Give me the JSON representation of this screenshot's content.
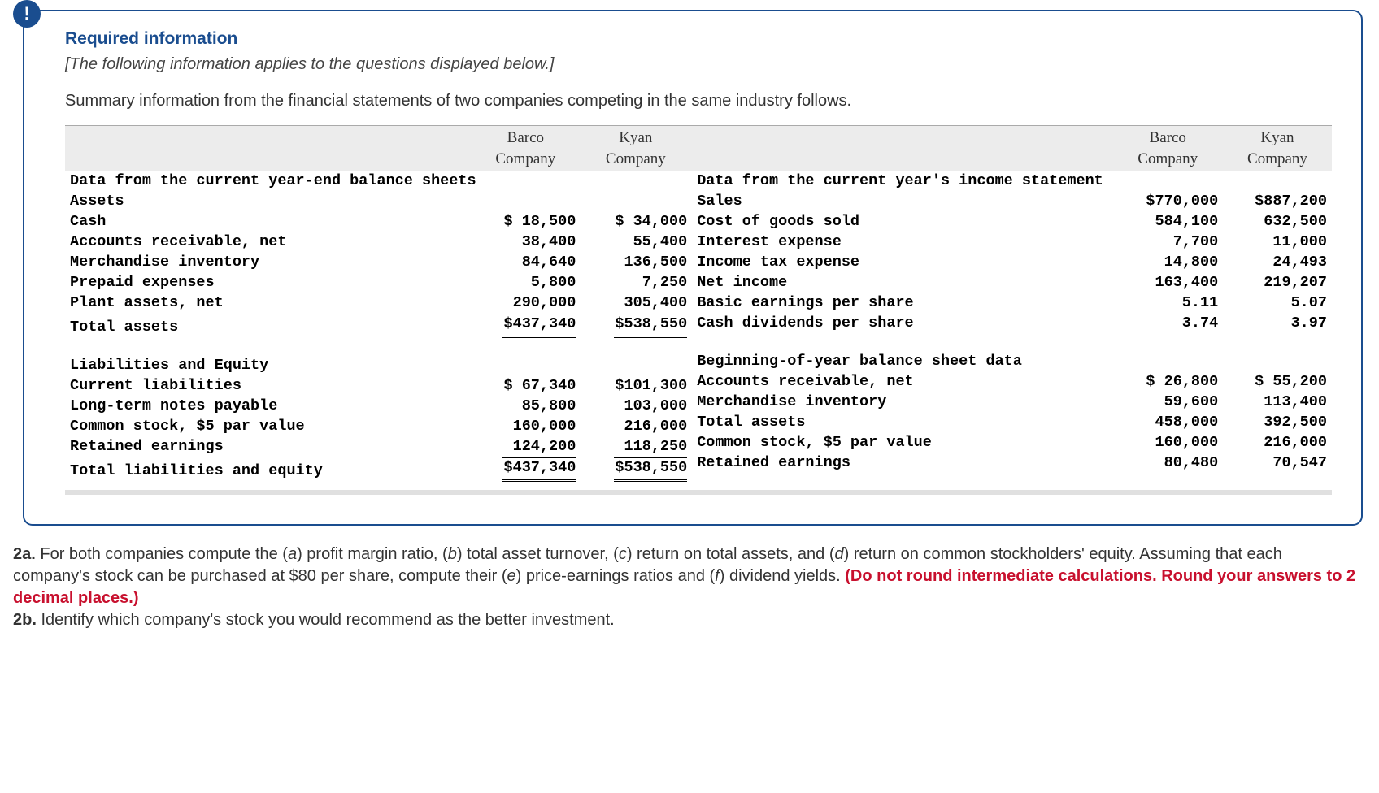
{
  "box": {
    "title": "Required information",
    "applies": "[The following information applies to the questions displayed below.]",
    "summary": "Summary information from the financial statements of two companies competing in the same industry follows."
  },
  "headers": {
    "c1": "Barco",
    "c1b": "Company",
    "c2": "Kyan",
    "c2b": "Company"
  },
  "left": {
    "h1": "Data from the current year-end balance sheets",
    "assets_hdr": "Assets",
    "rows1": [
      {
        "l": "Cash",
        "a": "$ 18,500",
        "b": "$ 34,000"
      },
      {
        "l": "Accounts receivable, net",
        "a": "38,400",
        "b": "55,400"
      },
      {
        "l": "Merchandise inventory",
        "a": "84,640",
        "b": "136,500"
      },
      {
        "l": "Prepaid expenses",
        "a": "5,800",
        "b": "7,250"
      },
      {
        "l": "Plant assets, net",
        "a": "290,000",
        "b": "305,400"
      }
    ],
    "total1": {
      "l": "Total assets",
      "a": "$437,340",
      "b": "$538,550"
    },
    "liab_hdr": "Liabilities and Equity",
    "rows2": [
      {
        "l": "Current liabilities",
        "a": "$ 67,340",
        "b": "$101,300"
      },
      {
        "l": "Long-term notes payable",
        "a": "85,800",
        "b": "103,000"
      },
      {
        "l": "Common stock, $5 par value",
        "a": "160,000",
        "b": "216,000"
      },
      {
        "l": "Retained earnings",
        "a": "124,200",
        "b": "118,250"
      }
    ],
    "total2": {
      "l": "Total liabilities and equity",
      "a": "$437,340",
      "b": "$538,550"
    }
  },
  "right": {
    "h1": "Data from the current year's income statement",
    "rows1": [
      {
        "l": "Sales",
        "a": "$770,000",
        "b": "$887,200"
      },
      {
        "l": "Cost of goods sold",
        "a": "584,100",
        "b": "632,500"
      },
      {
        "l": "Interest expense",
        "a": "7,700",
        "b": "11,000"
      },
      {
        "l": "Income tax expense",
        "a": "14,800",
        "b": "24,493"
      },
      {
        "l": "Net income",
        "a": "163,400",
        "b": "219,207"
      },
      {
        "l": "Basic earnings per share",
        "a": "5.11",
        "b": "5.07"
      },
      {
        "l": "Cash dividends per share",
        "a": "3.74",
        "b": "3.97"
      }
    ],
    "h2": "Beginning-of-year balance sheet data",
    "rows2": [
      {
        "l": "Accounts receivable, net",
        "a": "$ 26,800",
        "b": "$ 55,200"
      },
      {
        "l": "Merchandise inventory",
        "a": "59,600",
        "b": "113,400"
      },
      {
        "l": "Total assets",
        "a": "458,000",
        "b": "392,500"
      },
      {
        "l": "Common stock, $5 par value",
        "a": "160,000",
        "b": "216,000"
      },
      {
        "l": "Retained earnings",
        "a": "80,480",
        "b": "70,547"
      }
    ]
  },
  "q": {
    "p1a": "2a.",
    "p1b": " For both companies compute the (",
    "a": "a",
    "p1c": ") profit margin ratio, (",
    "b": "b",
    "p1d": ") total asset turnover, (",
    "c": "c",
    "p1e": ") return on total assets, and (",
    "d": "d",
    "p1f": ") return on common stockholders' equity. Assuming that each company's stock can be purchased at $80 per share, compute their (",
    "e": "e",
    "p1g": ") price-earnings ratios and (",
    "f": "f",
    "p1h": ") dividend yields. ",
    "red": "(Do not round intermediate calculations. Round your answers to 2 decimal places.)",
    "p2a": "2b.",
    "p2b": " Identify which company's stock you would recommend as the better investment."
  }
}
